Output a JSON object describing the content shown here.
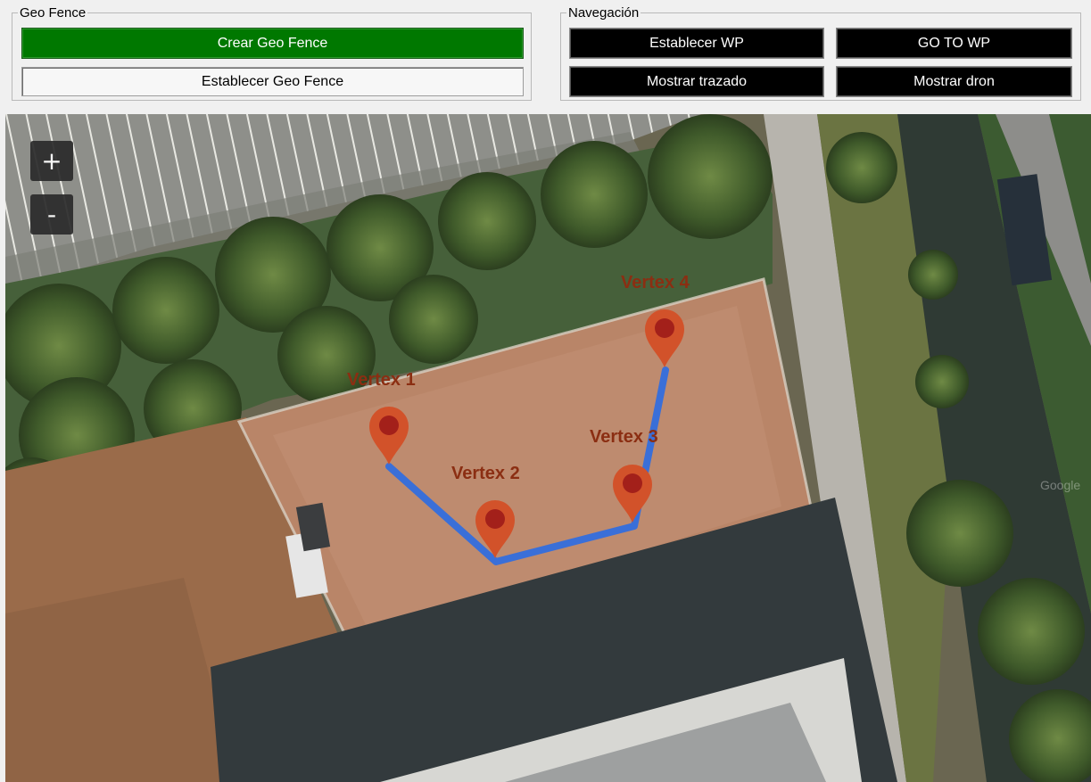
{
  "geofence": {
    "legend": "Geo Fence",
    "create_label": "Crear Geo Fence",
    "set_label": "Establecer Geo Fence"
  },
  "navigation": {
    "legend": "Navegación",
    "set_wp_label": "Establecer WP",
    "goto_wp_label": "GO TO WP",
    "show_path_label": "Mostrar trazado",
    "show_drone_label": "Mostrar dron"
  },
  "map": {
    "zoom_in": "+",
    "zoom_out": "-",
    "watermark": "Google",
    "vertices": [
      {
        "label": "Vertex 1"
      },
      {
        "label": "Vertex 2"
      },
      {
        "label": "Vertex 3"
      },
      {
        "label": "Vertex 4"
      }
    ]
  },
  "colors": {
    "path": "#3a6fd8",
    "marker": "#d2522a",
    "marker_dot": "#a3201a",
    "vertex_text": "#8b2e12",
    "create_button": "#007800"
  }
}
